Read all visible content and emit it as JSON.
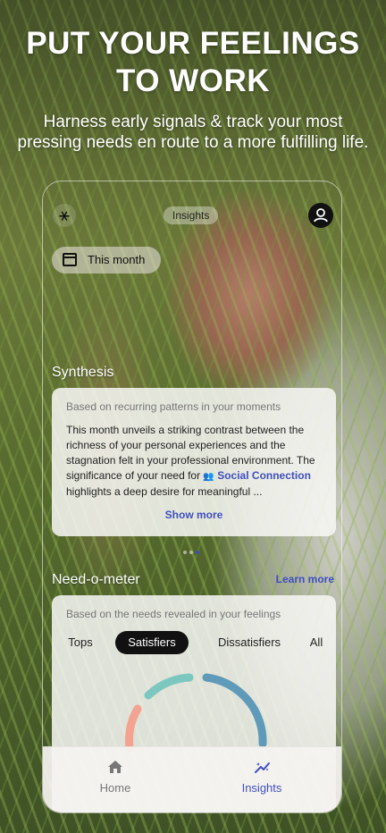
{
  "promo": {
    "headline_line1": "PUT YOUR FEELINGS",
    "headline_line2": "TO WORK",
    "subline_line1": "Harness early signals & track your most",
    "subline_line2": "pressing needs en route to a more fulfilling life."
  },
  "app": {
    "header": {
      "menu_icon": "⚹",
      "tab_label": "Insights"
    },
    "period": {
      "label": "This month"
    },
    "synthesis": {
      "title": "Synthesis",
      "caption": "Based on recurring patterns in your moments",
      "body_before": "This month unveils a striking contrast between the richness of your personal experiences and the stagnation felt in your professional environment. The significance of your need for ",
      "need_icon": "👥",
      "need_link": "Social Connection",
      "body_after": " highlights a deep desire for meaningful ...",
      "show_more": "Show more"
    },
    "need_o_meter": {
      "title": "Need-o-meter",
      "learn_more": "Learn more",
      "caption": "Based on the needs revealed in your feelings",
      "tabs": [
        "Tops",
        "Satisfiers",
        "Dissatisfiers",
        "All"
      ],
      "active_tab": "Satisfiers"
    },
    "nav": {
      "home": "Home",
      "insights": "Insights"
    },
    "colors": {
      "accent": "#3f4fbf",
      "gauge_salmon": "#f3a38f",
      "gauge_teal": "#7cc8c0",
      "gauge_blue": "#5f9ab8"
    }
  }
}
